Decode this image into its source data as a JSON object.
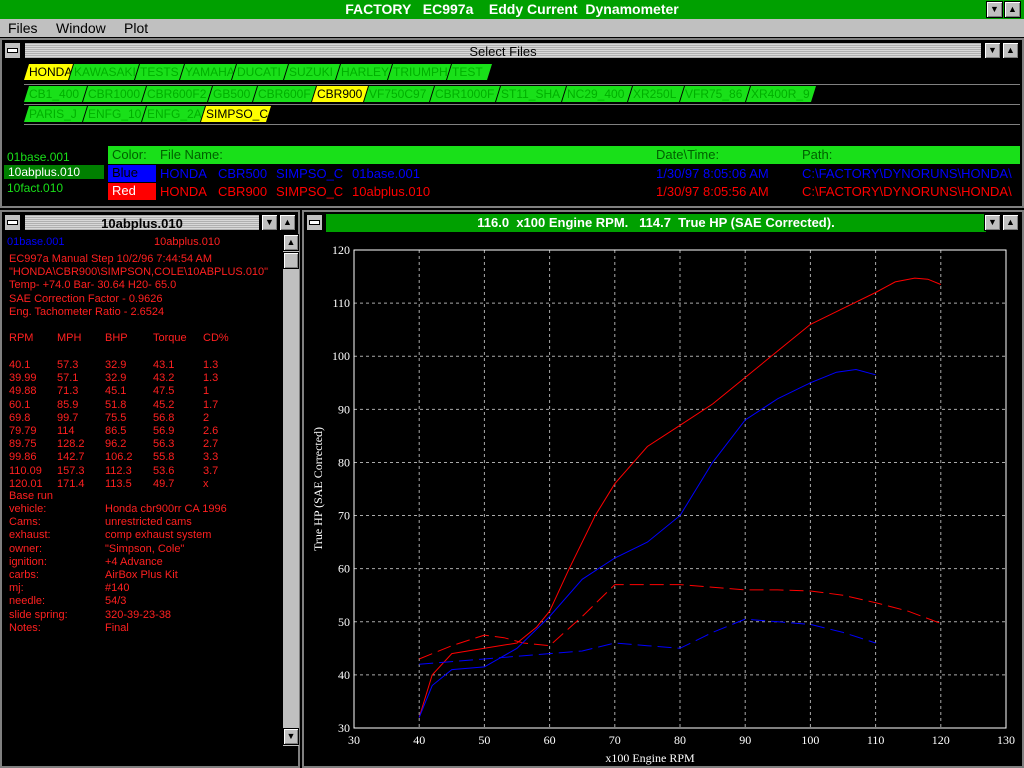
{
  "app": {
    "title": "FACTORY   EC997a    Eddy Current  Dynamometer",
    "menu": [
      "Files",
      "Window",
      "Plot"
    ]
  },
  "select_files": {
    "title": "Select Files",
    "tabs_row1": [
      {
        "label": "HONDA",
        "selected": true
      },
      {
        "label": "KAWASAKI",
        "selected": false
      },
      {
        "label": "TESTS",
        "selected": false
      },
      {
        "label": "YAMAHA",
        "selected": false
      },
      {
        "label": "DUCATI",
        "selected": false
      },
      {
        "label": "SUZUKI",
        "selected": false
      },
      {
        "label": "HARLEY",
        "selected": false
      },
      {
        "label": "TRIUMPH",
        "selected": false
      },
      {
        "label": "TEST",
        "selected": false
      }
    ],
    "tabs_row2": [
      {
        "label": "CB1_400",
        "selected": false
      },
      {
        "label": "CBR1000",
        "selected": false
      },
      {
        "label": "CBR600F2",
        "selected": false
      },
      {
        "label": "GB500",
        "selected": false
      },
      {
        "label": "CBR600F",
        "selected": false
      },
      {
        "label": "CBR900",
        "selected": true
      },
      {
        "label": "VF750C97",
        "selected": false
      },
      {
        "label": "CBR1000F",
        "selected": false
      },
      {
        "label": "ST11_SHA",
        "selected": false
      },
      {
        "label": "NC29_400",
        "selected": false
      },
      {
        "label": "XR250L",
        "selected": false
      },
      {
        "label": "VFR75_86",
        "selected": false
      },
      {
        "label": "XR400R_9",
        "selected": false
      }
    ],
    "tabs_row3": [
      {
        "label": "PARIS_J",
        "selected": false
      },
      {
        "label": "ENFG_10",
        "selected": false
      },
      {
        "label": "ENFG_2A",
        "selected": false
      },
      {
        "label": "SIMPSO_C",
        "selected": true
      }
    ],
    "file_list": [
      "01base.001",
      "10abplus.010",
      "10fact.010"
    ],
    "file_list_selected": "10abplus.010",
    "columns": {
      "color": "Color:",
      "file": "File Name:",
      "date": "Date\\Time:",
      "path": "Path:"
    },
    "rows": [
      {
        "color_name": "Blue",
        "color": "#0000ff",
        "make": "HONDA",
        "model": "CBR500",
        "owner": "SIMPSO_C",
        "file": "01base.001",
        "date": "1/30/97 8:05:06 AM",
        "path": "C:\\FACTORY\\DYNORUNS\\HONDA\\"
      },
      {
        "color_name": "Red",
        "color": "#ff0000",
        "make": "HONDA",
        "model": "CBR900",
        "owner": "SIMPSO_C",
        "file": "10abplus.010",
        "date": "1/30/97 8:05:56 AM",
        "path": "C:\\FACTORY\\DYNORUNS\\HONDA\\"
      }
    ]
  },
  "run_info": {
    "title": "10abplus.010",
    "tab_left": "01base.001",
    "tab_right": "10abplus.010",
    "header_lines": [
      "EC997a Manual Step  10/2/96 7:44:54 AM",
      "\"HONDA\\CBR900\\SIMPSON,COLE\\10ABPLUS.010\"",
      "Temp- +74.0  Bar- 30.64  H20- 65.0",
      "SAE Correction Factor - 0.9626",
      "Eng. Tachometer Ratio - 2.6524"
    ],
    "table_headers": [
      "RPM",
      "MPH",
      "BHP",
      "Torque",
      "CD%"
    ],
    "table_rows": [
      [
        "40.1",
        "57.3",
        "32.9",
        "43.1",
        "1.3"
      ],
      [
        "39.99",
        "57.1",
        "32.9",
        "43.2",
        "1.3"
      ],
      [
        "49.88",
        "71.3",
        "45.1",
        "47.5",
        "1"
      ],
      [
        "60.1",
        "85.9",
        "51.8",
        "45.2",
        "1.7"
      ],
      [
        "69.8",
        "99.7",
        "75.5",
        "56.8",
        "2"
      ],
      [
        "79.79",
        "114",
        "86.5",
        "56.9",
        "2.6"
      ],
      [
        "89.75",
        "128.2",
        "96.2",
        "56.3",
        "2.7"
      ],
      [
        "99.86",
        "142.7",
        "106.2",
        "55.8",
        "3.3"
      ],
      [
        "110.09",
        "157.3",
        "112.3",
        "53.6",
        "3.7"
      ],
      [
        "120.01",
        "171.4",
        "113.5",
        "49.7",
        "x"
      ]
    ],
    "notes_heading": "Base run",
    "notes": [
      [
        "vehicle:",
        "Honda cbr900rr CA 1996"
      ],
      [
        "Cams:",
        "unrestricted cams"
      ],
      [
        "exhaust:",
        "comp exhaust system"
      ],
      [
        "owner:",
        "\"Simpson, Cole\""
      ],
      [
        "ignition:",
        "+4 Advance"
      ],
      [
        "carbs:",
        "AirBox Plus Kit"
      ],
      [
        "mj:",
        "#140"
      ],
      [
        "needle:",
        "54/3"
      ],
      [
        "slide spring:",
        "320-39-23-38"
      ],
      [
        "Notes:",
        "Final"
      ]
    ]
  },
  "plot": {
    "title": "116.0  x100 Engine RPM.   114.7  True HP (SAE Corrected)."
  },
  "chart_data": {
    "type": "line",
    "xlabel": "x100 Engine RPM",
    "ylabel": "True HP (SAE Corrected)",
    "xlim": [
      30,
      130
    ],
    "ylim": [
      30,
      120
    ],
    "xticks": [
      30,
      40,
      50,
      60,
      70,
      80,
      90,
      100,
      110,
      120,
      130
    ],
    "yticks": [
      30,
      40,
      50,
      60,
      70,
      80,
      90,
      100,
      110,
      120
    ],
    "grid": true,
    "series": [
      {
        "kind": "hp",
        "color": "#ff0000",
        "x": [
          40,
          42,
          45,
          50,
          55,
          58,
          60,
          63,
          67,
          70,
          75,
          80,
          85,
          90,
          95,
          100,
          105,
          110,
          113,
          116,
          118,
          120
        ],
        "y": [
          32,
          40,
          44,
          45,
          46,
          49,
          52,
          60,
          70,
          76,
          83,
          87,
          91,
          96,
          101,
          106,
          109,
          112,
          114,
          114.7,
          114.5,
          113.5
        ]
      },
      {
        "kind": "torque",
        "color": "#ff0000",
        "x": [
          40,
          45,
          50,
          53,
          56,
          60,
          65,
          70,
          75,
          80,
          85,
          90,
          95,
          100,
          105,
          110,
          115,
          120
        ],
        "y": [
          43,
          45.5,
          47.5,
          47,
          46,
          45.5,
          51,
          57,
          57,
          57,
          56.5,
          56,
          56,
          55.8,
          55,
          53.6,
          52,
          49.7
        ]
      },
      {
        "kind": "hp",
        "color": "#0000ff",
        "x": [
          40,
          42,
          45,
          50,
          55,
          60,
          65,
          70,
          75,
          80,
          85,
          90,
          95,
          100,
          104,
          107,
          110
        ],
        "y": [
          32,
          38,
          41,
          41.5,
          45,
          51,
          58,
          62,
          65,
          70,
          80,
          88,
          92,
          95,
          97,
          97.5,
          96.5
        ]
      },
      {
        "kind": "torque",
        "color": "#0000ff",
        "x": [
          40,
          45,
          50,
          55,
          60,
          65,
          70,
          75,
          80,
          85,
          90,
          95,
          100,
          105,
          110
        ],
        "y": [
          42,
          42.5,
          43,
          43.5,
          44,
          44.5,
          46,
          45.5,
          45,
          48,
          50.5,
          50,
          49.5,
          48,
          46
        ]
      }
    ]
  }
}
